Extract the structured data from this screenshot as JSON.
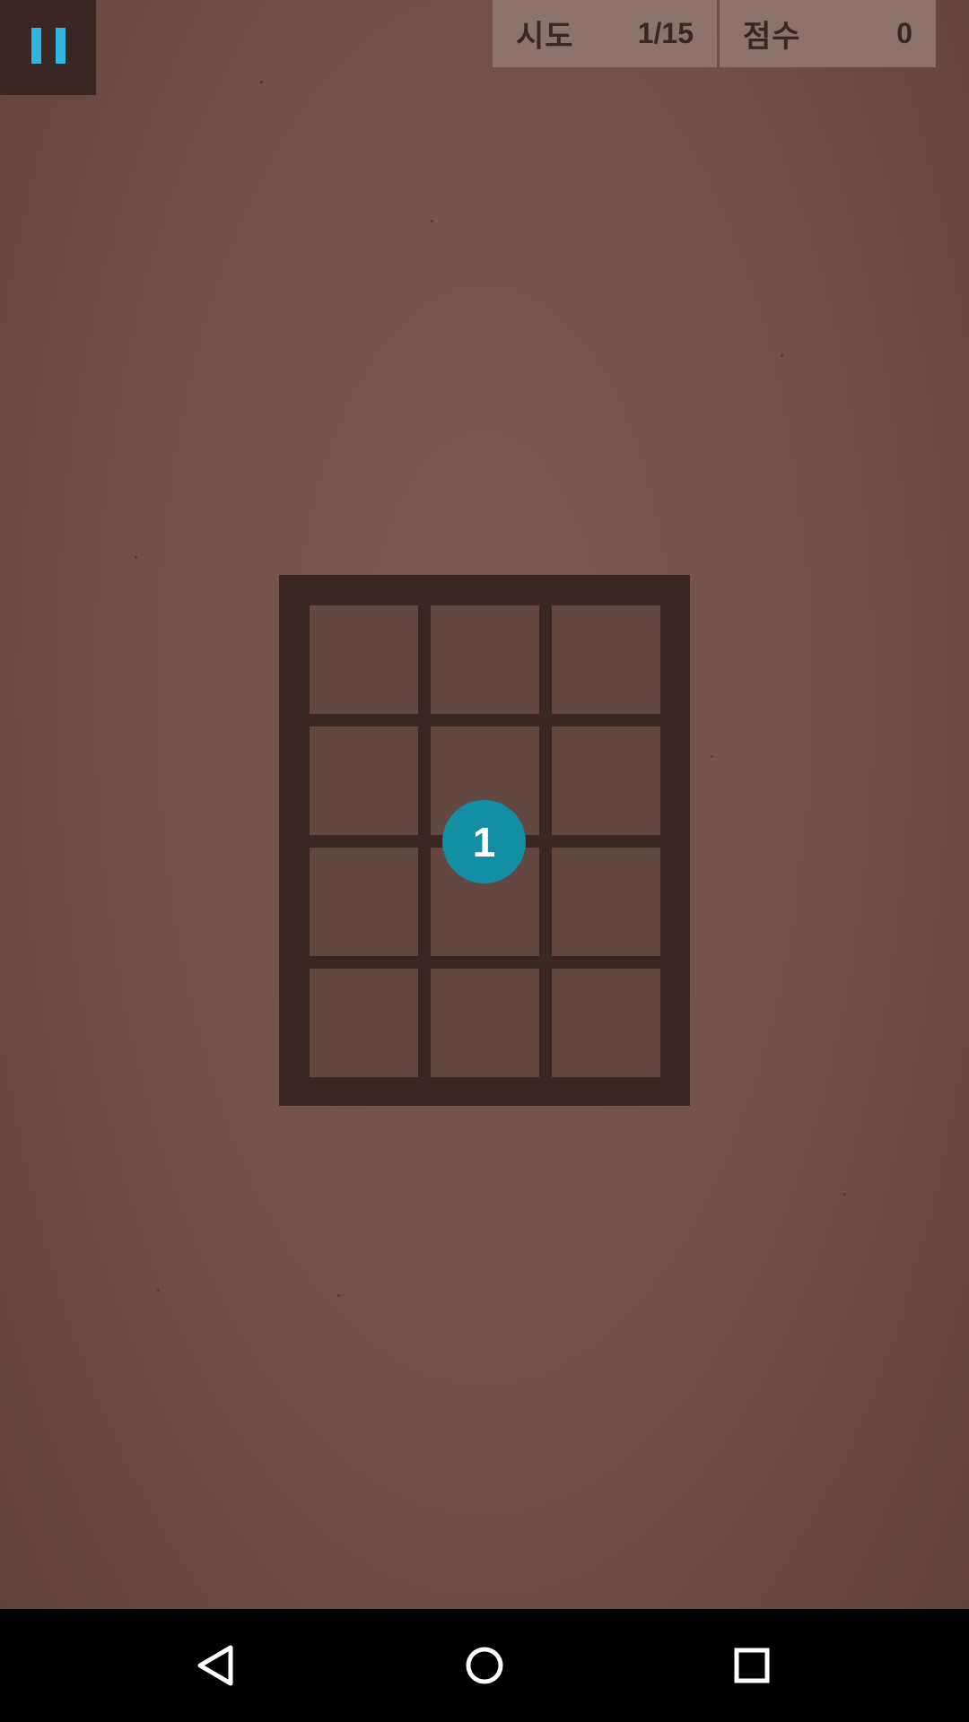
{
  "hud": {
    "tries_label": "시도",
    "tries_value": "1/15",
    "score_label": "점수",
    "score_value": "0"
  },
  "board": {
    "rows": 4,
    "cols": 3,
    "token": {
      "label": "1",
      "row": 2,
      "col": 2
    }
  },
  "icons": {
    "pause": "pause-icon",
    "back": "back-triangle-icon",
    "home": "home-circle-icon",
    "recents": "recents-square-icon"
  },
  "colors": {
    "background": "#6f4f48",
    "board_frame": "#3a2723",
    "cell": "#634841",
    "token": "#138ea3",
    "pause_accent": "#2eb5e0",
    "hud_panel": "#8e736d"
  }
}
